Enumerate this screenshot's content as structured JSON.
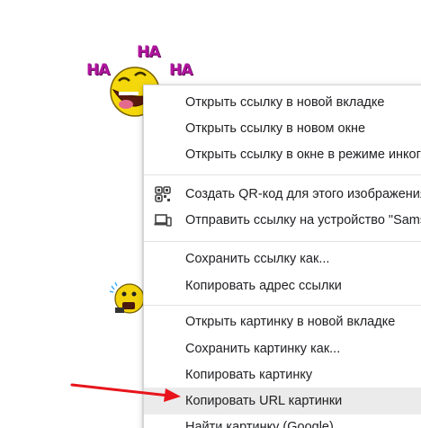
{
  "emoticons": {
    "laugh_ha": [
      "HA",
      "HA",
      "HA"
    ]
  },
  "context_menu": {
    "items": [
      {
        "label": "Открыть ссылку в новой вкладке"
      },
      {
        "label": "Открыть ссылку в новом окне"
      },
      {
        "label": "Открыть ссылку в окне в режиме инкогнито"
      },
      {
        "label": "Создать QR-код для этого изображения",
        "icon": "qr-code-icon"
      },
      {
        "label": "Отправить ссылку на устройство \"Samsung\"",
        "icon": "devices-icon"
      },
      {
        "label": "Сохранить ссылку как..."
      },
      {
        "label": "Копировать адрес ссылки"
      },
      {
        "label": "Открыть картинку в новой вкладке"
      },
      {
        "label": "Сохранить картинку как..."
      },
      {
        "label": "Копировать картинку"
      },
      {
        "label": "Копировать URL картинки",
        "highlighted": true
      },
      {
        "label": "Найти картинку (Google)"
      }
    ]
  },
  "colors": {
    "annotation_arrow": "#e8141b",
    "menu_hover": "#ebebeb",
    "ha_text": "#b0159e"
  }
}
